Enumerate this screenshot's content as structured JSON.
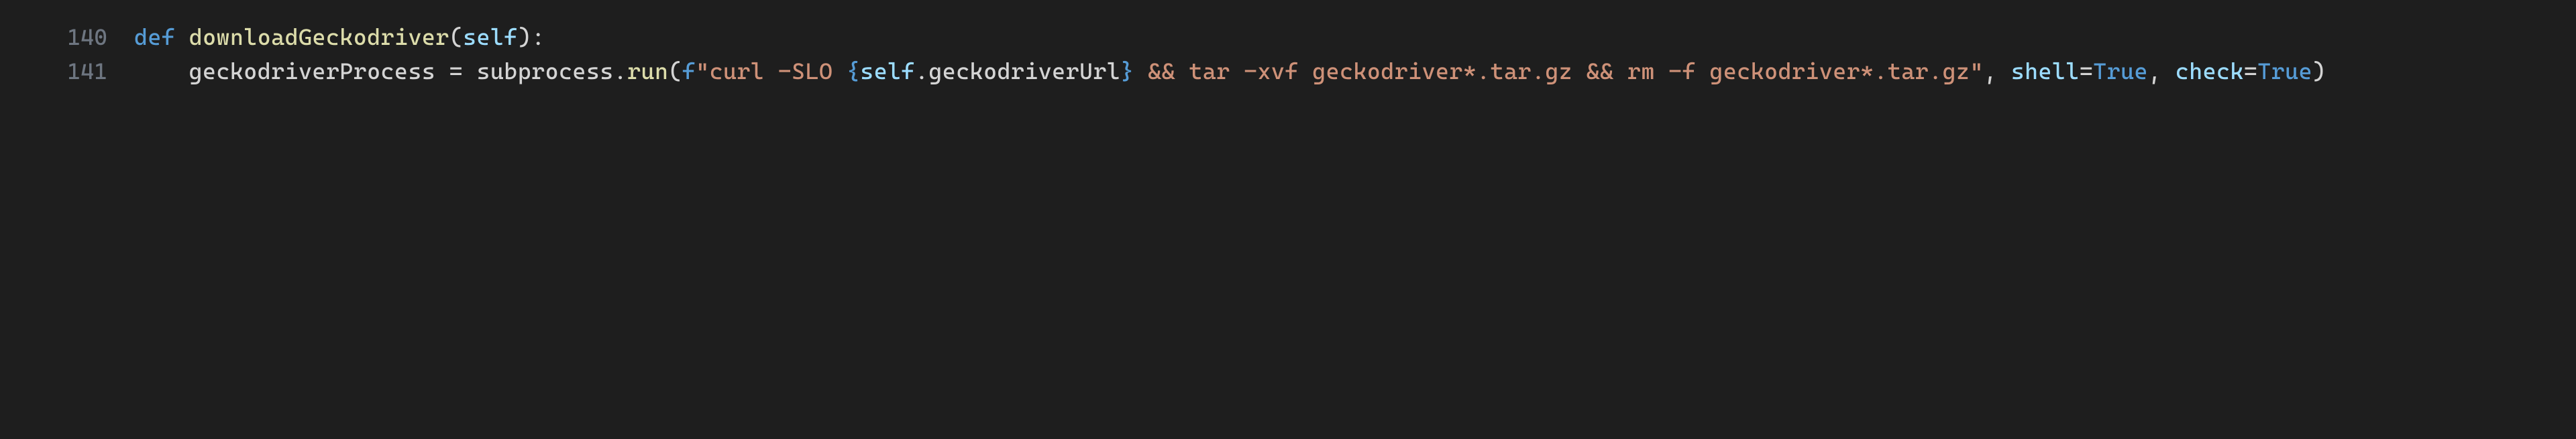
{
  "lines": {
    "l1": {
      "num": "140"
    },
    "l2": {
      "num": "141"
    }
  },
  "tok": {
    "def": "def",
    "space": " ",
    "fn": "downloadGeckodriver",
    "lparen": "(",
    "self": "self",
    "rparen": ")",
    "colon": ":",
    "var": "geckodriverProcess",
    "eq": " = ",
    "subprocess": "subprocess",
    "dot": ".",
    "run": "run",
    "f": "f",
    "q": "\"",
    "s1": "curl -SLO ",
    "lbrace": "{",
    "attr": "geckodriverUrl",
    "rbrace": "}",
    "s2": " && tar -xvf geckodriver*.tar.gz && rm -f geckodriver*.tar.gz",
    "comma": ", ",
    "shell": "shell",
    "eq2": "=",
    "true": "True",
    "check": "check"
  }
}
